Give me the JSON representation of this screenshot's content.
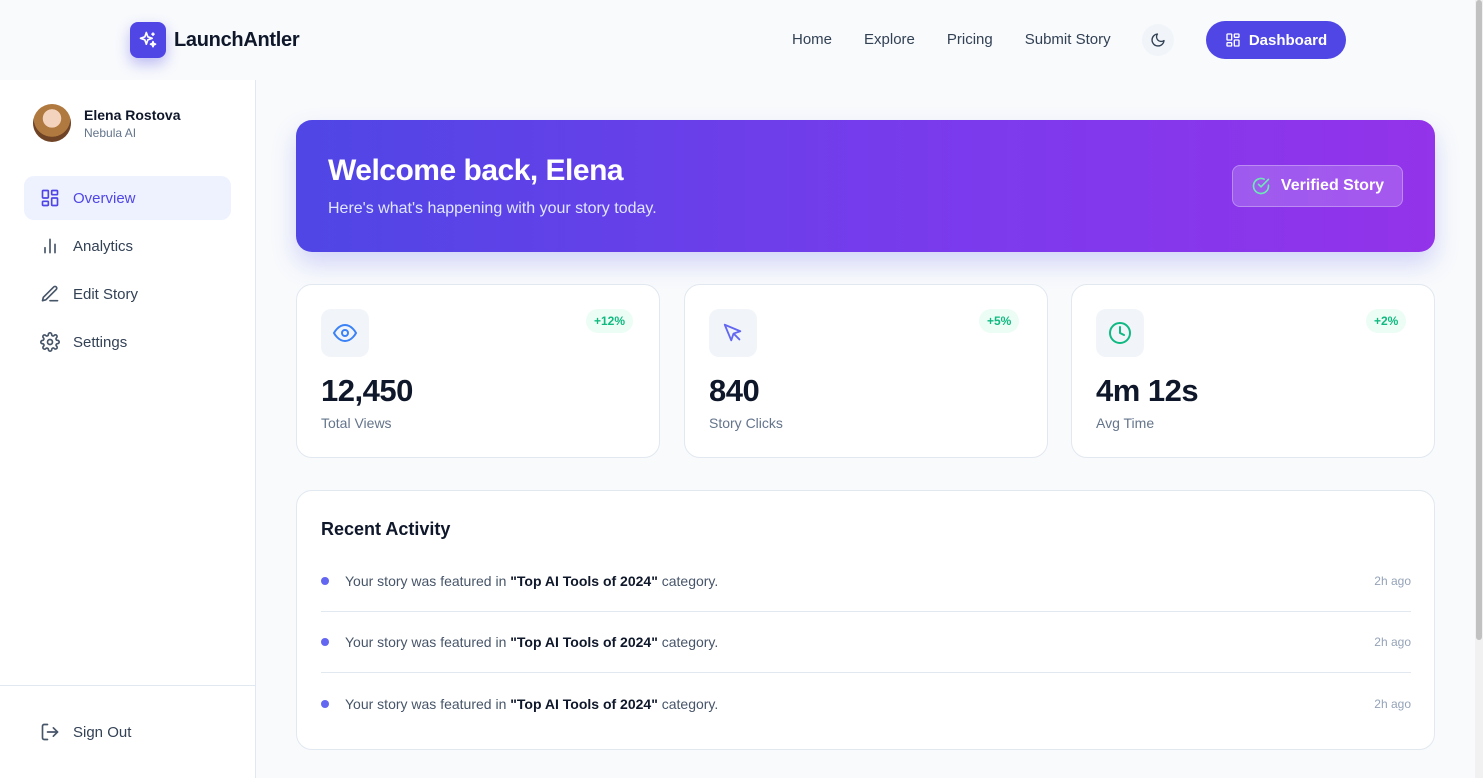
{
  "brand": {
    "name": "LaunchAntler",
    "logo_icon": "sparkles-icon",
    "accent": "#4f46e5"
  },
  "nav": {
    "links": [
      {
        "label": "Home"
      },
      {
        "label": "Explore"
      },
      {
        "label": "Pricing"
      },
      {
        "label": "Submit Story"
      }
    ],
    "theme_toggle_icon": "moon-icon",
    "dashboard_button": {
      "label": "Dashboard",
      "icon": "grid-icon"
    }
  },
  "user": {
    "name": "Elena Rostova",
    "org": "Nebula AI"
  },
  "sidebar": {
    "items": [
      {
        "label": "Overview",
        "icon": "grid-icon",
        "active": true
      },
      {
        "label": "Analytics",
        "icon": "bar-chart-icon",
        "active": false
      },
      {
        "label": "Edit Story",
        "icon": "pen-icon",
        "active": false
      },
      {
        "label": "Settings",
        "icon": "gear-icon",
        "active": false
      }
    ],
    "sign_out": {
      "label": "Sign Out",
      "icon": "log-out-icon"
    }
  },
  "hero": {
    "title": "Welcome back, Elena",
    "subtitle": "Here's what's happening with your story today.",
    "badge": "Verified Story",
    "gradient_colors": [
      "#4f46e5",
      "#9333ea"
    ]
  },
  "stats": [
    {
      "value": "12,450",
      "label": "Total Views",
      "change": "+12%",
      "icon": "eye-icon",
      "icon_color": "#3b82f6"
    },
    {
      "value": "840",
      "label": "Story Clicks",
      "change": "+5%",
      "icon": "cursor-icon",
      "icon_color": "#6366f1"
    },
    {
      "value": "4m 12s",
      "label": "Avg Time",
      "change": "+2%",
      "icon": "clock-icon",
      "icon_color": "#10b981"
    }
  ],
  "activity": {
    "title": "Recent Activity",
    "items": [
      {
        "prefix": "Your story was featured in ",
        "highlight": "\"Top AI Tools of 2024\"",
        "suffix": " category.",
        "time": "2h ago"
      },
      {
        "prefix": "Your story was featured in ",
        "highlight": "\"Top AI Tools of 2024\"",
        "suffix": " category.",
        "time": "2h ago"
      },
      {
        "prefix": "Your story was featured in ",
        "highlight": "\"Top AI Tools of 2024\"",
        "suffix": " category.",
        "time": "2h ago"
      }
    ]
  }
}
